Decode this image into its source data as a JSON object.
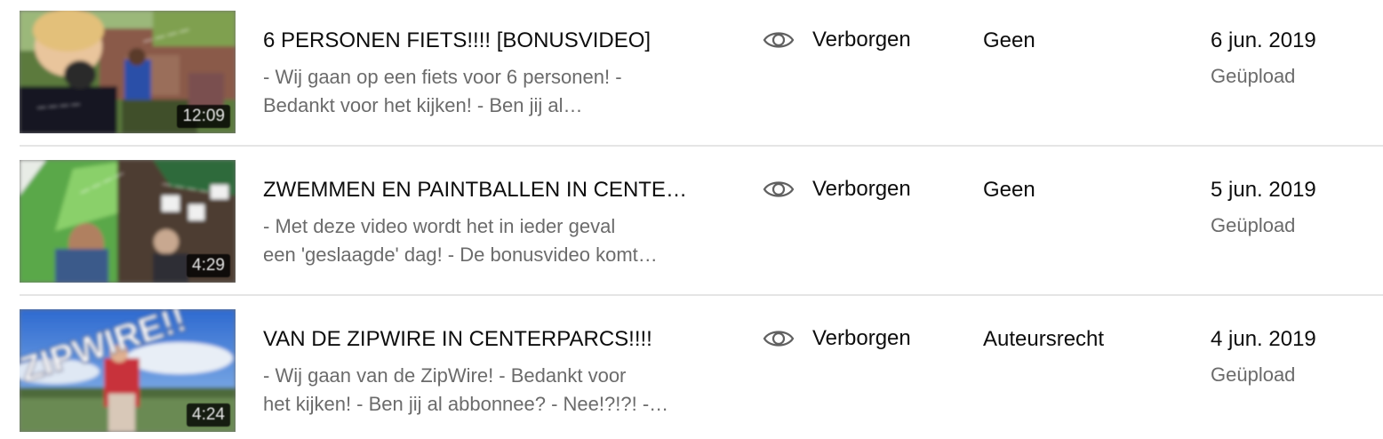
{
  "videos": [
    {
      "title": "6 PERSONEN FIETS!!!! [BONUSVIDEO]",
      "description_line1": "- Wij gaan op een fiets voor 6 personen! -",
      "description_line2": "Bedankt voor het kijken! - Ben jij al…",
      "duration": "12:09",
      "visibility": "Verborgen",
      "visibility_icon": "eye-icon",
      "restrictions": "Geen",
      "date": "6 jun. 2019",
      "date_status": "Geüpload"
    },
    {
      "title": "ZWEMMEN EN PAINTBALLEN IN CENTE…",
      "description_line1": "- Met deze video wordt het in ieder geval",
      "description_line2": "een 'geslaagde' dag! - De bonusvideo komt…",
      "duration": "4:29",
      "visibility": "Verborgen",
      "visibility_icon": "eye-icon",
      "restrictions": "Geen",
      "date": "5 jun. 2019",
      "date_status": "Geüpload"
    },
    {
      "title": "VAN DE ZIPWIRE IN CENTERPARCS!!!!",
      "description_line1": "- Wij gaan van de ZipWire! - Bedankt voor",
      "description_line2": "het kijken! - Ben jij al abbonnee? - Nee!?!?! -…",
      "duration": "4:24",
      "visibility": "Verborgen",
      "visibility_icon": "eye-icon",
      "restrictions": "Auteursrecht",
      "date": "4 jun. 2019",
      "date_status": "Geüpload"
    }
  ],
  "thumbnail_text": {
    "zipwire_banner": "ZIPWIRE!!"
  },
  "colors": {
    "divider": "#e5e5e5",
    "primary_text": "#0d0d0d",
    "secondary_text": "#6b6b6b"
  }
}
